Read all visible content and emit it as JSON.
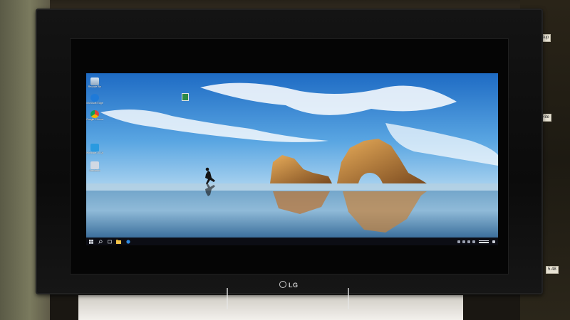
{
  "desktop": {
    "icons": [
      {
        "label": "Recycle Bin",
        "icon": "recycle-bin-icon"
      },
      {
        "label": "Microsoft Edge",
        "icon": "edge-icon"
      },
      {
        "label": "Google Chrome",
        "icon": "chrome-icon"
      },
      {
        "label": "Windows 10 Update Assistant",
        "icon": "windows-icon"
      },
      {
        "label": "Activation",
        "icon": "activation-icon"
      }
    ]
  },
  "taskbar": {
    "pinned": [
      "windows-start-icon",
      "search-icon",
      "task-view-icon",
      "file-explorer-icon",
      "edge-icon"
    ]
  },
  "bezel": {
    "brand": "LG"
  },
  "shelf": {
    "labels": [
      "Power Sup",
      "Scan Rite",
      "490",
      "2x2",
      "5.48"
    ]
  },
  "colors": {
    "sky_top": "#1e6bc4",
    "sky_bottom": "#8cc3ec",
    "taskbar": "#0c0d14",
    "rock": "#c98a3a"
  }
}
